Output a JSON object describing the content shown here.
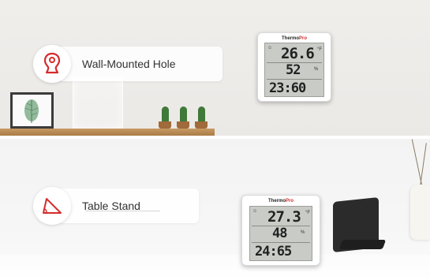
{
  "callouts": {
    "wall": {
      "label": "Wall-Mounted Hole",
      "icon": "wall-hole-icon"
    },
    "stand": {
      "label": "Table Stand",
      "icon": "table-stand-icon"
    }
  },
  "device_top": {
    "brand_prefix": "Thermo",
    "brand_suffix": "Pro",
    "temperature": "26.6",
    "humidity": "52",
    "time": "23:60"
  },
  "device_bottom": {
    "brand_prefix": "Thermo",
    "brand_suffix": "Pro",
    "temperature": "27.3",
    "humidity": "48",
    "time": "24:65"
  },
  "colors": {
    "accent_red": "#d42b2b",
    "wall_bg": "#ebe9e6",
    "shelf_wood": "#b68350"
  }
}
